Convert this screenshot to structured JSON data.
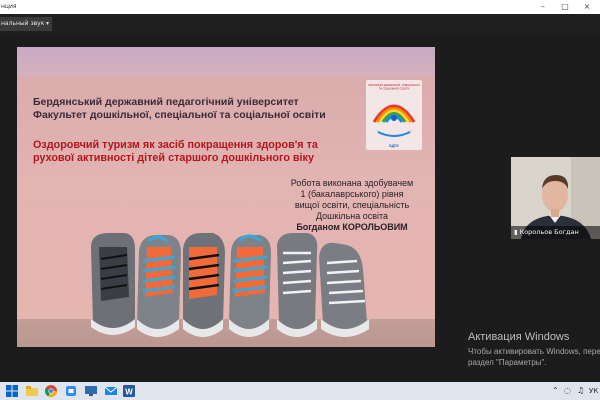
{
  "window": {
    "title": "нция"
  },
  "audio": {
    "dropdown_label": "нальный звук"
  },
  "slide": {
    "university_line1": "Бердянський державний педагогічний університет",
    "university_line2": "Факультет дошкільної, спеціальної та соціальної освіти",
    "topic_line1": "Оздоровчий туризм як засіб покращення здоров'я та",
    "topic_line2": "рухової активності дітей старшого дошкільного віку",
    "author_line1": "Робота виконана здобувачем",
    "author_line2": "1 (бакалаврського) рівня",
    "author_line3": "вищої освіти, спеціальність",
    "author_line4": "Дошкільна освіта",
    "author_name": "Богданом КОРОЛЬОВИМ",
    "logo_caption_line1": "ФАКУЛЬТЕТ ДОШКІЛЬНОЇ, СПЕЦІАЛЬНОЇ",
    "logo_caption_line2": "ТА СОЦІАЛЬНОЇ ОСВІТИ",
    "logo_abbr": "БДПУ"
  },
  "participant": {
    "name": "Корольов Богдан"
  },
  "watermark": {
    "title": "Активация Windows",
    "line1": "Чтобы активировать Windows, перей",
    "line2": "раздел \"Параметры\"."
  },
  "taskbar": {
    "apps": [
      "start-icon",
      "file-explorer-icon",
      "chrome-icon",
      "app-icon",
      "monitor-icon",
      "mail-icon",
      "word-icon"
    ],
    "tray_language": "УК"
  },
  "colors": {
    "topic_red": "#b3171c",
    "shoe_blue": "#3aa7d6",
    "shoe_orange": "#f06a3a"
  }
}
